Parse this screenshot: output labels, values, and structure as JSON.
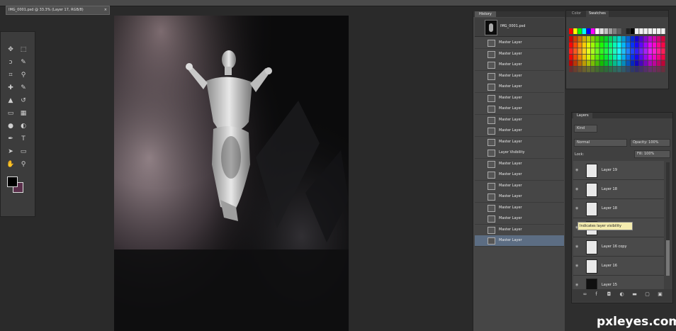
{
  "document_tab": {
    "title": "IMG_0001.psd @ 33.3% (Layer 17, RGB/8)",
    "close": "×"
  },
  "tools": [
    {
      "name": "move-tool",
      "glyph": "✥"
    },
    {
      "name": "marquee-tool",
      "glyph": "⬚"
    },
    {
      "name": "lasso-tool",
      "glyph": "ↄ"
    },
    {
      "name": "quick-select-tool",
      "glyph": "✎"
    },
    {
      "name": "crop-tool",
      "glyph": "⌗"
    },
    {
      "name": "eyedropper-tool",
      "glyph": "⚲"
    },
    {
      "name": "healing-tool",
      "glyph": "✚"
    },
    {
      "name": "brush-tool",
      "glyph": "✎"
    },
    {
      "name": "stamp-tool",
      "glyph": "▲"
    },
    {
      "name": "history-brush-tool",
      "glyph": "↺"
    },
    {
      "name": "eraser-tool",
      "glyph": "▭"
    },
    {
      "name": "gradient-tool",
      "glyph": "▦"
    },
    {
      "name": "blur-tool",
      "glyph": "●"
    },
    {
      "name": "dodge-tool",
      "glyph": "◐"
    },
    {
      "name": "pen-tool",
      "glyph": "✒"
    },
    {
      "name": "type-tool",
      "glyph": "T"
    },
    {
      "name": "path-select-tool",
      "glyph": "➤"
    },
    {
      "name": "shape-tool",
      "glyph": "▭"
    },
    {
      "name": "hand-tool",
      "glyph": "✋"
    },
    {
      "name": "zoom-tool",
      "glyph": "⚲"
    }
  ],
  "history": {
    "tab": "History",
    "snapshot": "IMG_0001.psd",
    "rows": [
      "Master Layer",
      "Master Layer",
      "Master Layer",
      "Master Layer",
      "Master Layer",
      "Master Layer",
      "Master Layer",
      "Master Layer",
      "Master Layer",
      "Master Layer",
      "Layer Visibility",
      "Master Layer",
      "Master Layer",
      "Master Layer",
      "Master Layer",
      "Master Layer",
      "Master Layer",
      "Master Layer",
      "Master Layer"
    ]
  },
  "swatches": {
    "tab_color": "Color",
    "tab_swatches": "Swatches"
  },
  "layers": {
    "tab": "Layers",
    "filter": "Kind",
    "blend": "Normal",
    "opacity": "Opacity: 100%",
    "lock": "Lock:",
    "fill": "Fill: 100%",
    "rows": [
      {
        "name": "Layer 19",
        "dark": false
      },
      {
        "name": "Layer 18",
        "dark": false
      },
      {
        "name": "Layer 18",
        "dark": false
      },
      {
        "name": "Layer 17",
        "dark": false
      },
      {
        "name": "Layer 16 copy",
        "dark": false
      },
      {
        "name": "Layer 16",
        "dark": false
      },
      {
        "name": "Layer 15",
        "dark": true
      }
    ],
    "tooltip": "Indicates layer visibility"
  },
  "watermark": "pxleyes.com"
}
